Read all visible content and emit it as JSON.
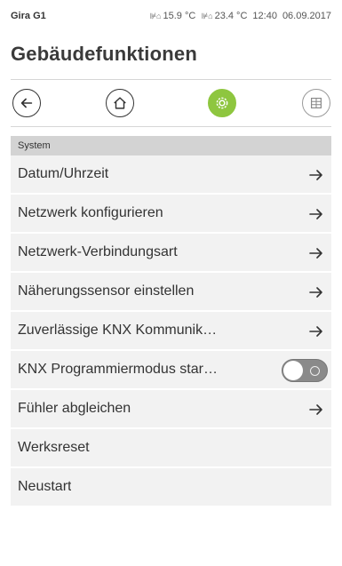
{
  "statusbar": {
    "device_name": "Gira G1",
    "temp_indoor": "15.9 °C",
    "temp_outdoor": "23.4 °C",
    "time": "12:40",
    "date": "06.09.2017"
  },
  "page": {
    "title": "Gebäudefunktionen"
  },
  "nav": {
    "back_icon": "arrow-left-icon",
    "home_icon": "house-icon",
    "settings_icon": "gear-icon",
    "grid_icon": "grid-icon",
    "active_color": "#8ec63f"
  },
  "section": {
    "header": "System"
  },
  "items": [
    {
      "label": "Datum/Uhrzeit",
      "control": "arrow"
    },
    {
      "label": "Netzwerk konfigurieren",
      "control": "arrow"
    },
    {
      "label": "Netzwerk-Verbindungsart",
      "control": "arrow"
    },
    {
      "label": "Näherungssensor einstellen",
      "control": "arrow"
    },
    {
      "label": "Zuverlässige KNX Kommunik…",
      "control": "arrow"
    },
    {
      "label": "KNX Programmiermodus star…",
      "control": "toggle",
      "toggle_state": "off"
    },
    {
      "label": "Fühler abgleichen",
      "control": "arrow"
    },
    {
      "label": "Werksreset",
      "control": "none"
    },
    {
      "label": "Neustart",
      "control": "none"
    }
  ]
}
